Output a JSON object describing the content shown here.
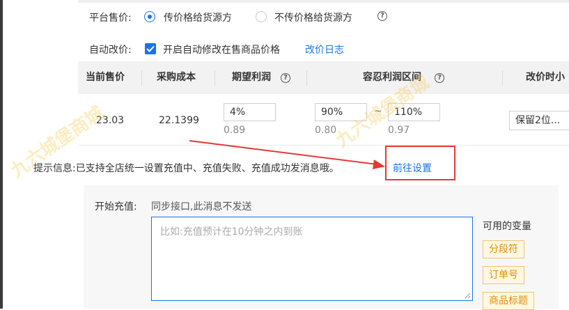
{
  "watermark": "九六城堡商城",
  "price_sync": {
    "label": "平台售价:",
    "option_pass": "传价格给货源方",
    "option_no_pass": "不传价格给货源方",
    "selected": "传价格给货源方",
    "help_glyph": "?"
  },
  "auto_reprice": {
    "label": "自动改价:",
    "checkbox_label": "开启自动修改在售商品价格",
    "checked": true,
    "log_link": "改价日志"
  },
  "table": {
    "headers": [
      "当前售价",
      "采购成本",
      "期望利润",
      "容忍利润区间",
      "改价时小"
    ],
    "help_glyph": "?",
    "row": {
      "current_price": "23.03",
      "purchase_cost": "22.1399",
      "expected_profit_input": "4%",
      "expected_profit_value": "0.89",
      "tolerance_min_input": "90%",
      "tolerance_min_value": "0.80",
      "range_separator": "~",
      "tolerance_max_input": "110%",
      "tolerance_max_value": "0.97",
      "decimal_select": "保留2位..."
    }
  },
  "notice": {
    "text": "提示信息:已支持全店统一设置充值中、充值失败、充值成功发消息哦。",
    "link": "前往设置"
  },
  "start_recharge": {
    "label": "开始充值:",
    "note": "同步接口,此消息不发送",
    "placeholder": "比如:充值预计在10分钟之内到账",
    "variables_title": "可用的变量",
    "variables": [
      "分段符",
      "订单号",
      "商品标题"
    ]
  },
  "colors": {
    "accent": "#1a73e8",
    "annotation_red": "#e53935",
    "chip_text": "#e08e0b",
    "chip_border": "#f0c36d"
  }
}
